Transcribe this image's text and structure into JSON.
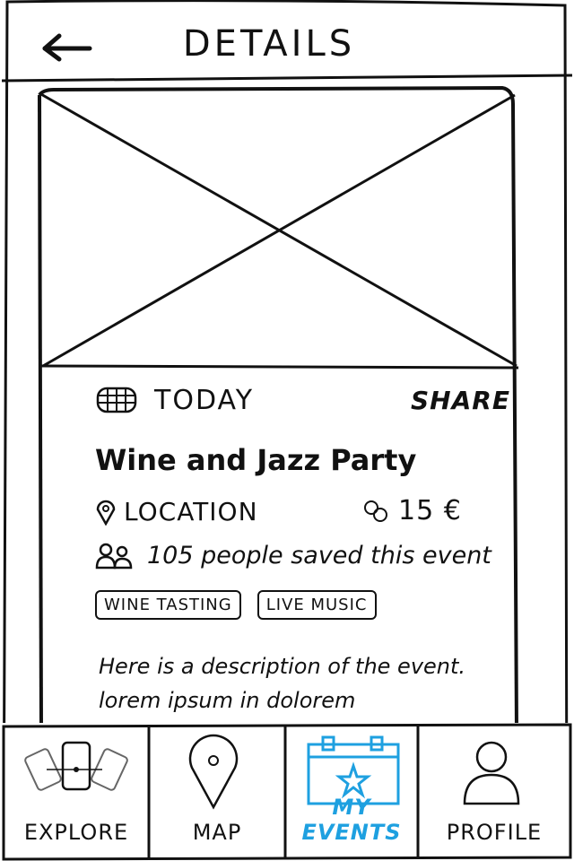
{
  "header": {
    "title": "DETAILS"
  },
  "event": {
    "date": "TODAY",
    "share_label": "SHARE",
    "title": "Wine and Jazz Party",
    "location": "LOCATION",
    "price": "15 €",
    "saved": "105 people saved this event",
    "tags": [
      "WINE TASTING",
      "LIVE MUSIC"
    ],
    "description": "Here is a description of the event. lorem ipsum in dolorem"
  },
  "nav": {
    "items": [
      {
        "label": "EXPLORE",
        "icon": "cards-icon"
      },
      {
        "label": "MAP",
        "icon": "map-pin-icon"
      },
      {
        "label": "MY EVENTS",
        "icon": "calendar-star-icon"
      },
      {
        "label": "PROFILE",
        "icon": "person-icon"
      }
    ],
    "active_color": "#1ea0e0"
  }
}
